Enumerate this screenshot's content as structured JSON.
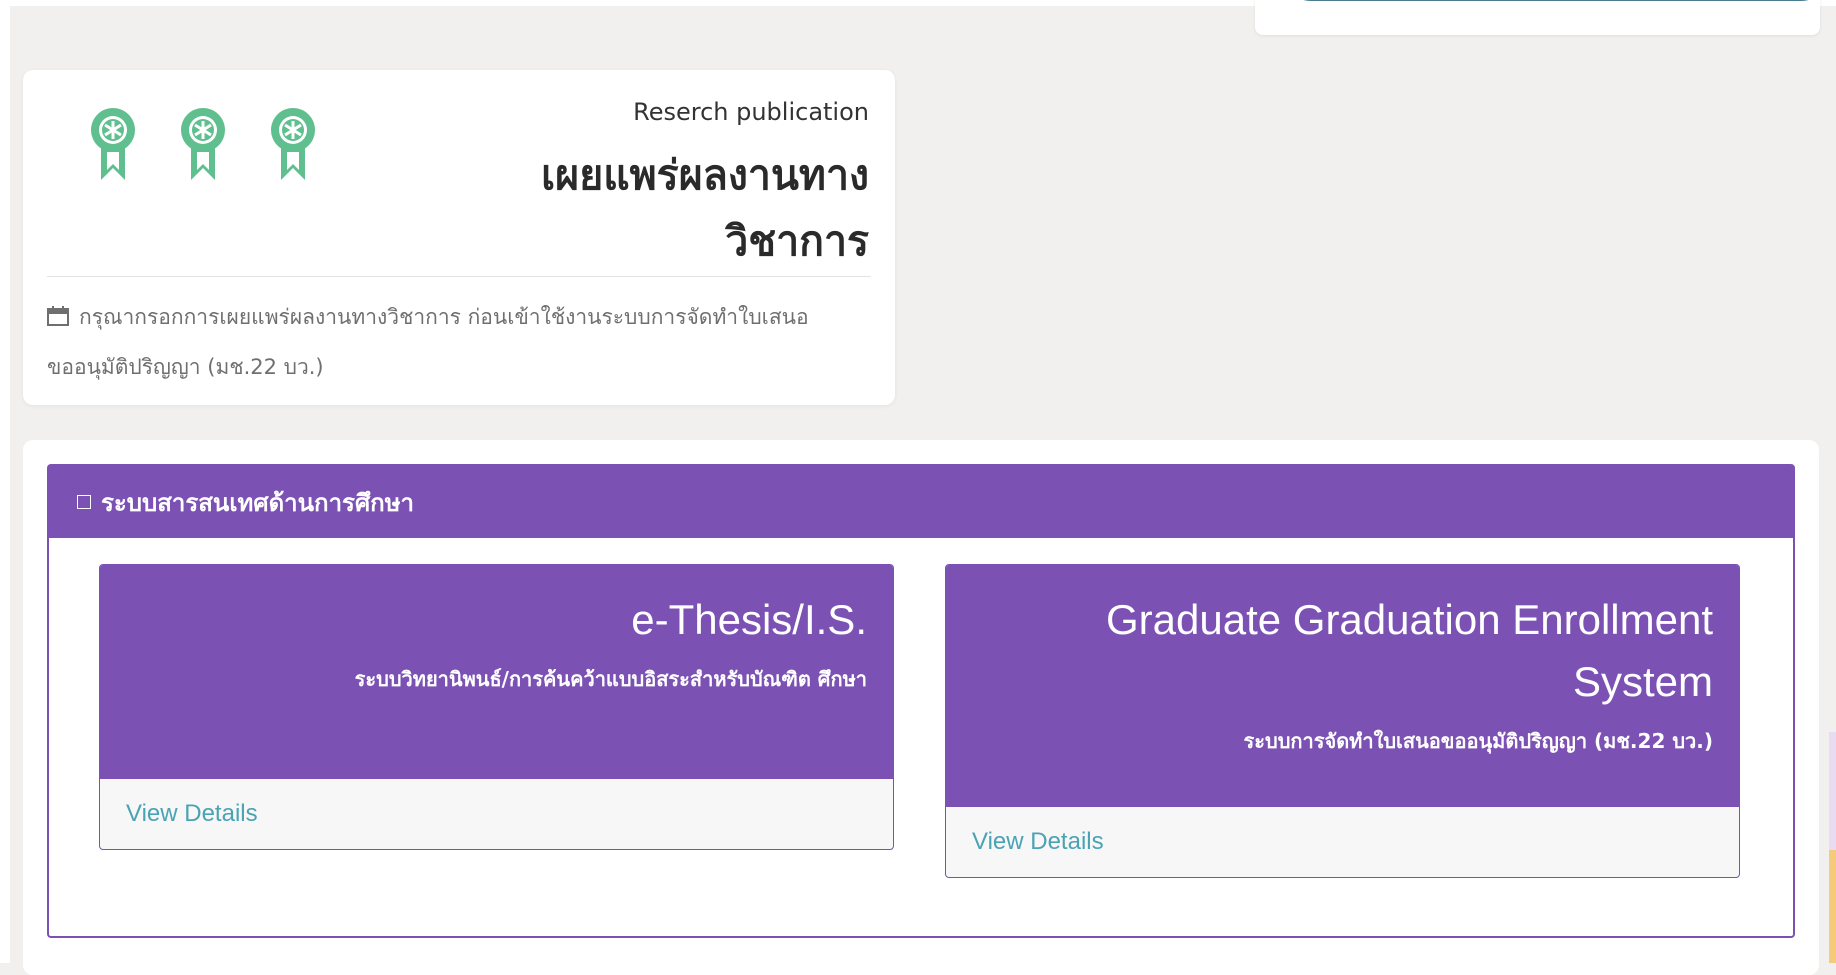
{
  "publication_card": {
    "badges": [
      "award-ribbon-icon",
      "award-ribbon-icon",
      "award-ribbon-icon"
    ],
    "badge_color": "#5fbf8e",
    "subtitle": "Reserch publication",
    "title_line1": "เผยแพร่ผลงานทาง",
    "title_line2": "วิชาการ",
    "note_line1": "กรุณากรอกการเผยแพร่ผลงานทางวิชาการ ก่อนเข้าใช้งานระบบการจัดทำใบเสนอ",
    "note_line2": "ขออนุมัติปริญญา (มช.22 บว.)"
  },
  "systems": {
    "header_title": "ระบบสารสนเทศด้านการศึกษา",
    "accent_color": "#7b52b3",
    "cards": [
      {
        "title": "e-Thesis/I.S.",
        "description": "ระบบวิทยานิพนธ์/การค้นคว้าแบบอิสระสำหรับบัณฑิต ศึกษา",
        "link_label": "View Details"
      },
      {
        "title": "Graduate Graduation Enrollment System",
        "description": "ระบบการจัดทำใบเสนอขออนุมัติปริญญา (มช.22 บว.)",
        "link_label": "View Details"
      }
    ]
  },
  "link_color": "#4aa3b3"
}
